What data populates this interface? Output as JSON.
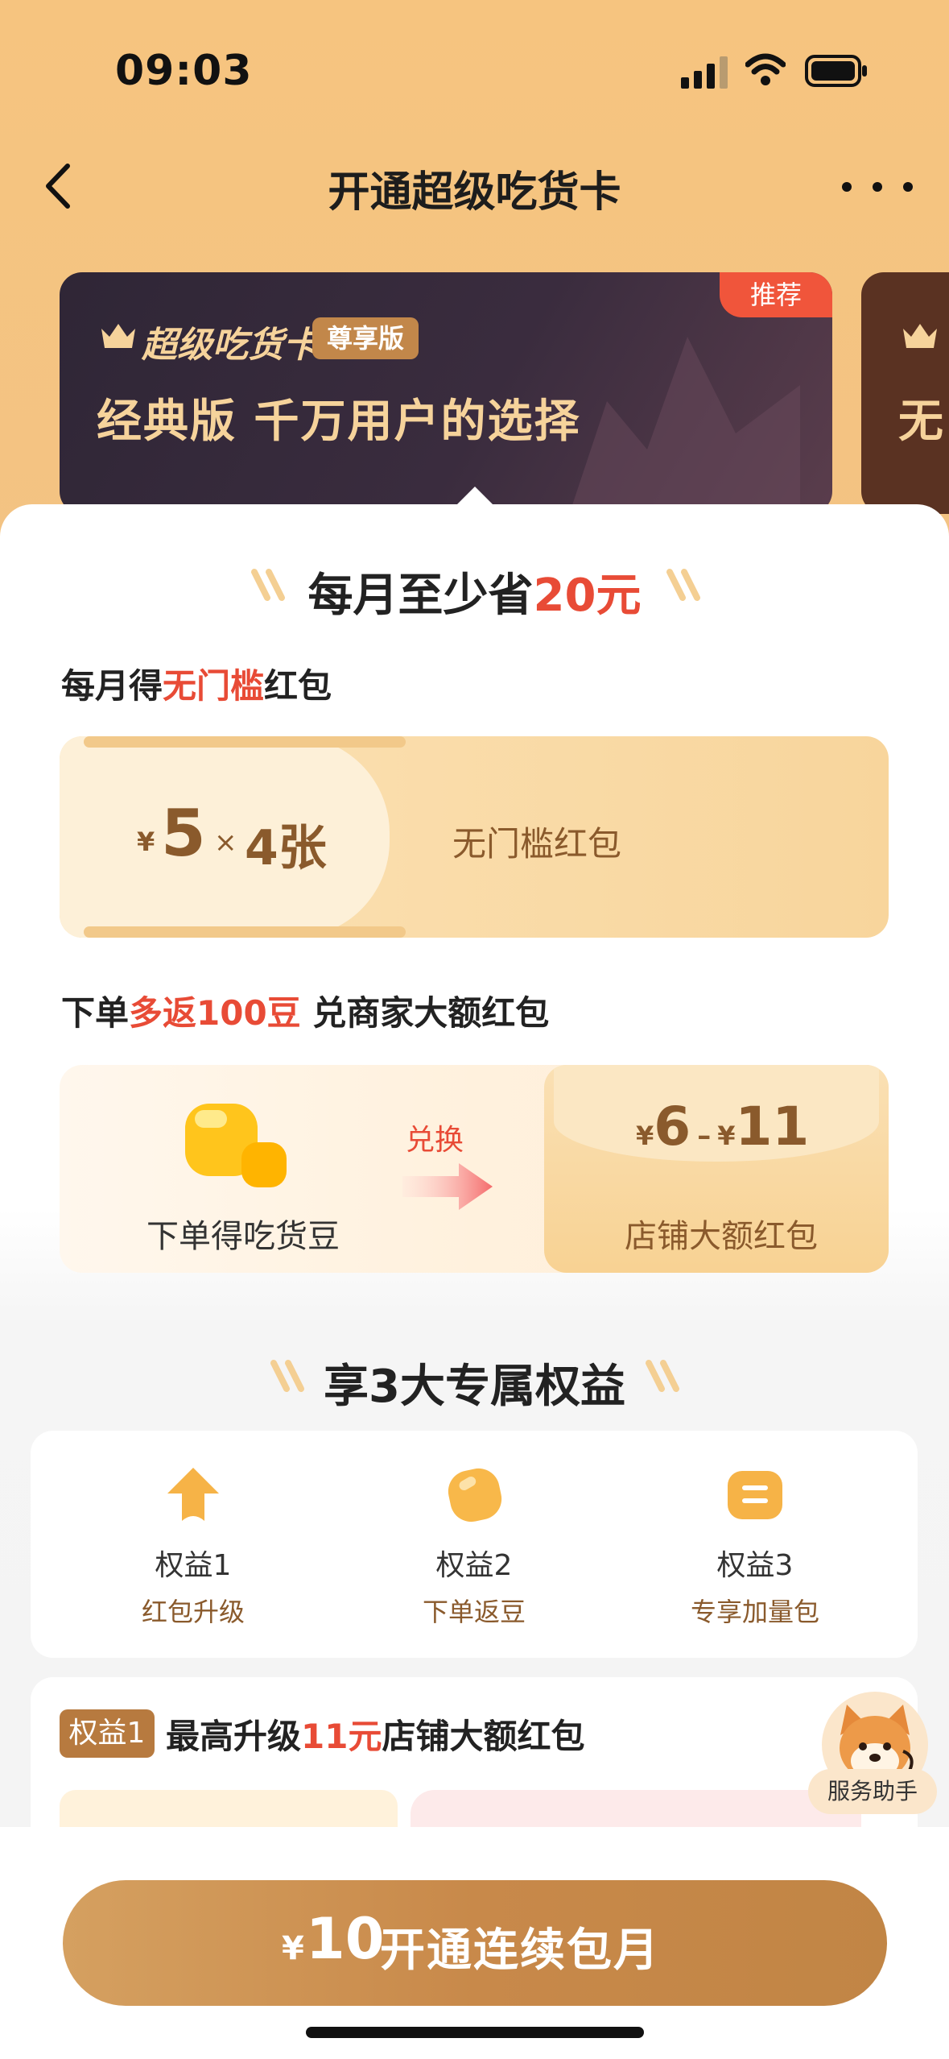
{
  "status_bar": {
    "time": "09:03"
  },
  "nav": {
    "title": "开通超级吃货卡"
  },
  "plan_card": {
    "brand": "超级吃货卡",
    "edition_badge": "尊享版",
    "recommend_badge": "推荐",
    "subtitle": "经典版 千万用户的选择"
  },
  "plan_card_2": {
    "subtitle_partial": "无"
  },
  "savings": {
    "prefix": "每月至少省",
    "amount": "20元"
  },
  "monthly_coupon": {
    "label_prefix": "每月得",
    "label_highlight": "无门槛",
    "label_suffix": "红包",
    "currency": "¥",
    "amount": "5",
    "times": "×",
    "count": "4张",
    "name": "无门槛红包"
  },
  "beans": {
    "label_prefix": "下单",
    "label_highlight": "多返100豆",
    "label_suffix": " 兑商家大额红包",
    "left_label": "下单得吃货豆",
    "exchange_word": "兑换",
    "range_yen1": "¥",
    "range_min": "6",
    "range_dash": "–",
    "range_yen2": "¥",
    "range_max": "11",
    "right_label": "店铺大额红包"
  },
  "benefits_section": {
    "title": "享3大专属权益"
  },
  "benefits": [
    {
      "title": "权益1",
      "subtitle": "红包升级",
      "icon": "arrow-up-icon"
    },
    {
      "title": "权益2",
      "subtitle": "下单返豆",
      "icon": "bean-icon"
    },
    {
      "title": "权益3",
      "subtitle": "专享加量包",
      "icon": "pack-icon"
    }
  ],
  "benefit_detail": {
    "tag": "权益1",
    "title_prefix": "最高升级",
    "title_highlight": "11元",
    "title_suffix": "店铺大额红包"
  },
  "assistant": {
    "label": "服务助手"
  },
  "cta": {
    "currency": "¥",
    "amount": "10",
    "label": "开通连续包月"
  },
  "colors": {
    "accent": "#e84b36",
    "brand_gold": "#c8894a",
    "header_bg": "#f6c47f"
  }
}
